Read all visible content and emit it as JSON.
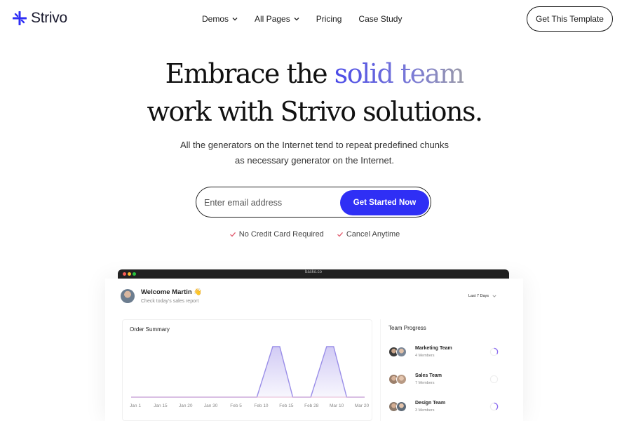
{
  "header": {
    "logo_text": "Strivo",
    "nav": [
      {
        "label": "Demos",
        "has_dropdown": true
      },
      {
        "label": "All Pages",
        "has_dropdown": true
      },
      {
        "label": "Pricing",
        "has_dropdown": false
      },
      {
        "label": "Case Study",
        "has_dropdown": false
      }
    ],
    "cta_label": "Get This Template"
  },
  "hero": {
    "title_line1_plain": "Embrace the",
    "title_line1_highlight": "solid team",
    "title_line2": "work with Strivo solutions.",
    "subtitle_line1": "All the generators on the Internet tend to repeat predefined chunks",
    "subtitle_line2": "as necessary generator on the Internet.",
    "email_placeholder": "Enter email address",
    "submit_label": "Get Started Now",
    "checks": [
      "No Credit Card Required",
      "Cancel Anytime"
    ]
  },
  "dashboard": {
    "url": "basko.co",
    "welcome_title": "Welcome Martin 👋",
    "welcome_subtitle": "Check today's sales report",
    "range_label": "Last 7 Days",
    "order_summary": {
      "title": "Order Summary",
      "chart_data": {
        "type": "area",
        "categories": [
          "Jan 1",
          "Jan 15",
          "Jan 20",
          "Jan 30",
          "Feb 5",
          "Feb 10",
          "Feb 15",
          "Feb 28",
          "Mar 10",
          "Mar 20"
        ],
        "values": [
          0,
          0,
          0,
          0,
          0,
          0,
          0,
          0,
          100,
          0,
          0,
          100,
          0,
          0
        ],
        "x_positions_label": "values sampled across categories"
      }
    },
    "team_progress": {
      "title": "Team Progress",
      "teams": [
        {
          "name": "Marketing Team",
          "members": "4 Members",
          "progress": 0.35,
          "color": "#8b6cf0"
        },
        {
          "name": "Sales Team",
          "members": "7 Members",
          "progress": 0.0,
          "color": "#e5e5e5"
        },
        {
          "name": "Design Team",
          "members": "3 Members",
          "progress": 0.4,
          "color": "#8b6cf0"
        }
      ]
    }
  },
  "colors": {
    "accent": "#2f2ff5",
    "check": "#e0566a",
    "chart_line": "#9a8ee8",
    "chart_fill": "#cfc8f4"
  }
}
